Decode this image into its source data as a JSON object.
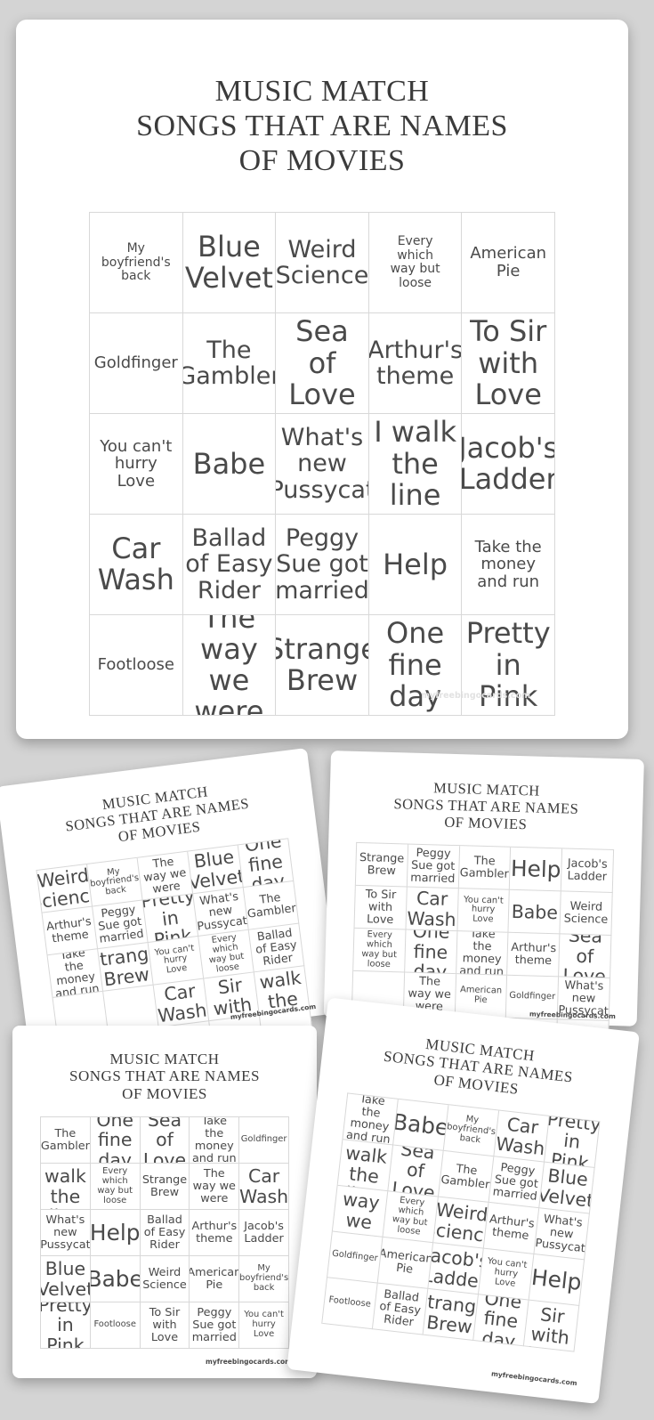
{
  "page": {
    "background_color": "#d4d4d4",
    "card_color": "#ffffff",
    "text_color": "#4a4a4a"
  },
  "title": "MUSIC MATCH\nSONGS THAT ARE NAMES\nOF MOVIES",
  "watermark": "myfreebingocards.com",
  "cards": {
    "main": {
      "title": "MUSIC MATCH\nSONGS THAT ARE NAMES\nOF MOVIES",
      "watermark": "myfreebingocards.com",
      "rows": [
        [
          "My\nboyfriend's\nback",
          "Blue\nVelvet",
          "Weird\nScience",
          "Every\nwhich\nway but\nloose",
          "American\nPie"
        ],
        [
          "Goldfinger",
          "The\nGambler",
          "Sea\nof\nLove",
          "Arthur's\ntheme",
          "To Sir\nwith\nLove"
        ],
        [
          "You can't\nhurry\nLove",
          "Babe",
          "What's\nnew\nPussycat",
          "I walk\nthe\nline",
          "Jacob's\nLadder"
        ],
        [
          "Car\nWash",
          "Ballad\nof Easy\nRider",
          "Peggy\nSue got\nmarried",
          "Help",
          "Take the\nmoney\nand run"
        ],
        [
          "Footloose",
          "The\nway we\nwere",
          "Strange\nBrew",
          "One\nfine\nday",
          "Pretty\nin Pink"
        ]
      ],
      "sizes": [
        [
          "xs",
          "xl",
          "lg",
          "xs",
          "sm"
        ],
        [
          "sm",
          "lg",
          "xl",
          "lg",
          "xl"
        ],
        [
          "sm",
          "xl",
          "lg",
          "xl",
          "xl"
        ],
        [
          "xl",
          "lg",
          "lg",
          "xl",
          "sm"
        ],
        [
          "sm",
          "xl",
          "xl",
          "xl",
          "xl"
        ]
      ]
    },
    "top_left": {
      "title": "MUSIC MATCH\nSONGS THAT ARE NAMES\nOF MOVIES",
      "watermark": "myfreebingocards.com",
      "rows": [
        [
          "Weird\nScience",
          "My\nboyfriend's\nback",
          "The\nway we\nwere",
          "Blue\nVelvet",
          "One\nfine\nday"
        ],
        [
          "Arthur's\ntheme",
          "Peggy\nSue got\nmarried",
          "Pretty\nin Pink",
          "What's\nnew\nPussycat",
          "The\nGambler"
        ],
        [
          "Take the\nmoney\nand run",
          "Strange\nBrew",
          "You can't\nhurry\nLove",
          "Every\nwhich\nway but\nloose",
          "Ballad\nof Easy\nRider"
        ],
        [
          "",
          "",
          "Car\nWash",
          "To Sir\nwith\nLove",
          "I walk\nthe\nline"
        ],
        [
          "",
          "",
          "",
          "",
          ""
        ]
      ],
      "sizes": [
        [
          "lg",
          "xs",
          "sm",
          "lg",
          "lg"
        ],
        [
          "sm",
          "sm",
          "lg",
          "sm",
          "sm"
        ],
        [
          "sm",
          "lg",
          "xs",
          "xs",
          "sm"
        ],
        [
          "sm",
          "sm",
          "lg",
          "lg",
          "lg"
        ],
        [
          "sm",
          "sm",
          "sm",
          "sm",
          "sm"
        ]
      ]
    },
    "top_right": {
      "title": "MUSIC MATCH\nSONGS THAT ARE NAMES\nOF MOVIES",
      "watermark": "myfreebingocards.com",
      "rows": [
        [
          "Strange\nBrew",
          "Peggy\nSue got\nmarried",
          "The\nGambler",
          "Help",
          "Jacob's\nLadder"
        ],
        [
          "To Sir\nwith\nLove",
          "Car\nWash",
          "You can't\nhurry\nLove",
          "Babe",
          "Weird\nScience"
        ],
        [
          "Every\nwhich\nway but\nloose",
          "One\nfine\nday",
          "Take the\nmoney\nand run",
          "Arthur's\ntheme",
          "Sea of\nLove"
        ],
        [
          "",
          "The\nway we\nwere",
          "American\nPie",
          "Goldfinger",
          "What's\nnew\nPussycat"
        ],
        [
          "",
          "",
          "",
          "",
          ""
        ]
      ],
      "sizes": [
        [
          "sm",
          "sm",
          "sm",
          "xl",
          "sm"
        ],
        [
          "sm",
          "lg",
          "xs",
          "lg",
          "sm"
        ],
        [
          "xs",
          "lg",
          "sm",
          "sm",
          "lg"
        ],
        [
          "sm",
          "sm",
          "xs",
          "xs",
          "sm"
        ],
        [
          "sm",
          "sm",
          "sm",
          "sm",
          "sm"
        ]
      ]
    },
    "bottom_left": {
      "title": "MUSIC MATCH\nSONGS THAT ARE NAMES\nOF MOVIES",
      "watermark": "myfreebingocards.com",
      "rows": [
        [
          "The\nGambler",
          "One\nfine\nday",
          "Sea of\nLove",
          "Take the\nmoney\nand run",
          "Goldfinger"
        ],
        [
          "I walk\nthe\nline",
          "Every\nwhich\nway but\nloose",
          "Strange\nBrew",
          "The\nway we\nwere",
          "Car\nWash"
        ],
        [
          "What's\nnew\nPussycat",
          "Help",
          "Ballad\nof Easy\nRider",
          "Arthur's\ntheme",
          "Jacob's\nLadder"
        ],
        [
          "Blue\nVelvet",
          "Babe",
          "Weird\nScience",
          "American\nPie",
          "My\nboyfriend's\nback"
        ],
        [
          "Pretty\nin Pink",
          "Footloose",
          "To Sir\nwith\nLove",
          "Peggy\nSue got\nmarried",
          "You can't\nhurry\nLove"
        ]
      ],
      "sizes": [
        [
          "sm",
          "lg",
          "lg",
          "sm",
          "xs"
        ],
        [
          "lg",
          "xs",
          "sm",
          "sm",
          "lg"
        ],
        [
          "sm",
          "xl",
          "sm",
          "sm",
          "sm"
        ],
        [
          "lg",
          "xl",
          "sm",
          "sm",
          "xs"
        ],
        [
          "lg",
          "xs",
          "sm",
          "sm",
          "xs"
        ]
      ]
    },
    "bottom_right": {
      "title": "MUSIC MATCH\nSONGS THAT ARE NAMES\nOF MOVIES",
      "watermark": "myfreebingocards.com",
      "rows": [
        [
          "Take the\nmoney\nand run",
          "Babe",
          "My\nboyfriend's\nback",
          "Car\nWash",
          "Pretty\nin Pink"
        ],
        [
          "I walk\nthe\nline",
          "Sea of\nLove",
          "The\nGambler",
          "Peggy\nSue got\nmarried",
          "Blue\nVelvet"
        ],
        [
          "The\nway we\nwere",
          "Every\nwhich\nway but\nloose",
          "Weird\nScience",
          "Arthur's\ntheme",
          "What's\nnew\nPussycat"
        ],
        [
          "Goldfinger",
          "American\nPie",
          "Jacob's\nLadder",
          "You can't\nhurry\nLove",
          "Help"
        ],
        [
          "Footloose",
          "Ballad\nof Easy\nRider",
          "Strange\nBrew",
          "One\nfine\nday",
          "To Sir\nwith\nLove"
        ]
      ],
      "sizes": [
        [
          "sm",
          "xl",
          "xs",
          "lg",
          "lg"
        ],
        [
          "lg",
          "lg",
          "sm",
          "sm",
          "lg"
        ],
        [
          "lg",
          "xs",
          "lg",
          "sm",
          "sm"
        ],
        [
          "xs",
          "sm",
          "lg",
          "xs",
          "xl"
        ],
        [
          "xs",
          "sm",
          "lg",
          "lg",
          "lg"
        ]
      ]
    }
  }
}
